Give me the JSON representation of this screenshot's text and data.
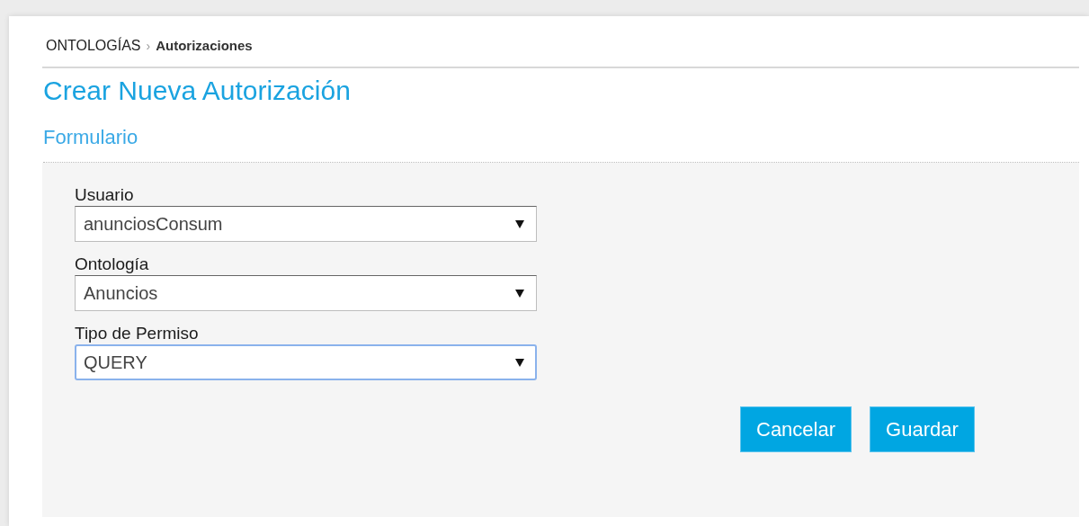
{
  "breadcrumb": {
    "parent": "ONTOLOGÍAS",
    "separator": "›",
    "current": "Autorizaciones"
  },
  "title": "Crear Nueva Autorización",
  "section_title": "Formulario",
  "fields": [
    {
      "label": "Usuario",
      "value": "anunciosConsum",
      "focused": false
    },
    {
      "label": "Ontología",
      "value": "Anuncios",
      "focused": false
    },
    {
      "label": "Tipo de Permiso",
      "value": "QUERY",
      "focused": true
    }
  ],
  "buttons": [
    "Cancelar",
    "Guardar"
  ]
}
